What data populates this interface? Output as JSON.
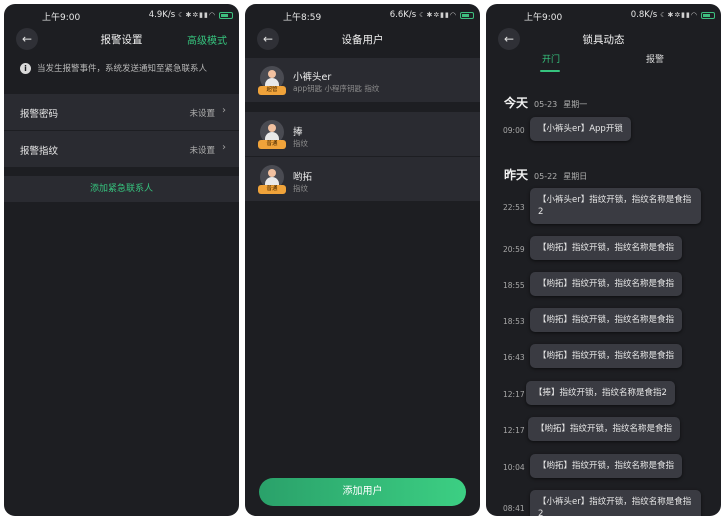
{
  "screen1": {
    "status": {
      "time": "上午9:00",
      "speed": "4.9K/s"
    },
    "nav": {
      "title": "报警设置",
      "action": "高级模式"
    },
    "notice": "当发生报警事件，系统发送通知至紧急联系人",
    "rows": [
      {
        "label": "报警密码",
        "value": "未设置"
      },
      {
        "label": "报警指纹",
        "value": "未设置"
      }
    ],
    "add_contact": "添加紧急联系人"
  },
  "screen2": {
    "status": {
      "time": "上午8:59",
      "speed": "6.6K/s"
    },
    "nav": {
      "title": "设备用户"
    },
    "users": [
      {
        "name": "小裤头er",
        "meta": "app钥匙  小程序钥匙  指纹",
        "badge": "超管"
      },
      {
        "name": "捧",
        "meta": "指纹",
        "badge": "普通"
      },
      {
        "name": "哟拓",
        "meta": "指纹",
        "badge": "普通"
      }
    ],
    "add_user": "添加用户"
  },
  "screen3": {
    "status": {
      "time": "上午9:00",
      "speed": "0.8K/s"
    },
    "nav": {
      "title": "锁具动态"
    },
    "tabs": [
      "开门",
      "报警"
    ],
    "today": {
      "label": "今天",
      "date": "05-23",
      "weekday": "星期一"
    },
    "yesterday": {
      "label": "昨天",
      "date": "05-22",
      "weekday": "星期日"
    },
    "today_events": [
      {
        "time": "09:00",
        "text": "【小裤头er】App开锁"
      }
    ],
    "yesterday_events": [
      {
        "time": "22:53",
        "text": "【小裤头er】指纹开锁，指纹名称是食指2"
      },
      {
        "time": "20:59",
        "text": "【哟拓】指纹开锁，指纹名称是食指"
      },
      {
        "time": "18:55",
        "text": "【哟拓】指纹开锁，指纹名称是食指"
      },
      {
        "time": "18:53",
        "text": "【哟拓】指纹开锁，指纹名称是食指"
      },
      {
        "time": "16:43",
        "text": "【哟拓】指纹开锁，指纹名称是食指"
      },
      {
        "time": "12:17",
        "text": "【捧】指纹开锁，指纹名称是食指2"
      },
      {
        "time": "12:17",
        "text": "【哟拓】指纹开锁，指纹名称是食指"
      },
      {
        "time": "10:04",
        "text": "【哟拓】指纹开锁，指纹名称是食指"
      },
      {
        "time": "08:41",
        "text": "【小裤头er】指纹开锁，指纹名称是食指2"
      }
    ]
  },
  "colors": {
    "background": "#1d1e22",
    "row": "#2a2b31",
    "accent": "#36c47e",
    "badge": "#f0a33a"
  }
}
